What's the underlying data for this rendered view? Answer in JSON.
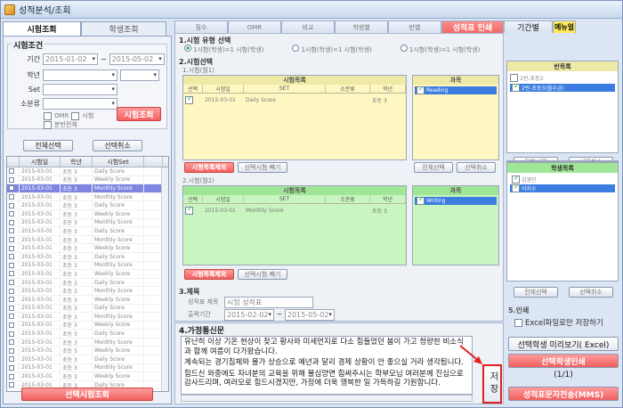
{
  "window": {
    "title": "성적분석/조회"
  },
  "left_tabs": [
    {
      "label": "시험조회",
      "active": true
    },
    {
      "label": "학생조회",
      "active": false
    }
  ],
  "left": {
    "condition_title": "시험조건",
    "period_label": "기간",
    "date_from": "2015-01-02",
    "date_to": "2015-05-02",
    "grade_label": "학년",
    "set_label": "Set",
    "class_label": "소분류",
    "check_omr": "OMR",
    "check_exam": "시험",
    "check_full": "분반전체",
    "search_button": "시험조회",
    "select_all": "전체선택",
    "deselect_all": "선택취소",
    "columns": [
      "",
      "시험일",
      "학년",
      "시험Set",
      ""
    ],
    "rows": [
      [
        "2015-03-01",
        "초등 3",
        "Daily Score"
      ],
      [
        "2015-03-01",
        "초등 3",
        "Weekly Score"
      ],
      [
        "2015-03-01",
        "초등 3",
        "Monthly Score"
      ],
      [
        "2015-03-01",
        "초등 3",
        "Monthly Score"
      ],
      [
        "2015-03-01",
        "초등 3",
        "Daily Score"
      ],
      [
        "2015-03-01",
        "초등 3",
        "Weekly Score"
      ],
      [
        "2015-03-01",
        "초등 3",
        "Monthly Score"
      ],
      [
        "2015-03-01",
        "초등 3",
        "Daily Score"
      ],
      [
        "2015-03-01",
        "초등 3",
        "Monthly Score"
      ],
      [
        "2015-03-01",
        "초등 3",
        "Weekly Score"
      ],
      [
        "2015-03-01",
        "초등 3",
        "Daily Score"
      ],
      [
        "2015-03-01",
        "초등 3",
        "Monthly Score"
      ],
      [
        "2015-03-01",
        "초등 3",
        "Weekly Score"
      ],
      [
        "2015-03-01",
        "초등 3",
        "Daily Score"
      ],
      [
        "2015-03-01",
        "초등 3",
        "Monthly Score"
      ],
      [
        "2015-03-01",
        "초등 3",
        "Weekly Score"
      ],
      [
        "2015-03-01",
        "초등 3",
        "Daily Score"
      ],
      [
        "2015-03-01",
        "초등 3",
        "Monthly Score"
      ],
      [
        "2015-03-01",
        "초등 3",
        "Weekly Score"
      ],
      [
        "2015-03-01",
        "초등 3",
        "Daily Score"
      ],
      [
        "2015-03-01",
        "초등 3",
        "Monthly Score"
      ],
      [
        "2015-03-01",
        "초등 3",
        "Weekly Score"
      ],
      [
        "2015-03-01",
        "초등 3",
        "Daily Score"
      ],
      [
        "2015-03-01",
        "초등 3",
        "Monthly Score"
      ],
      [
        "2015-03-01",
        "초등 3",
        "Weekly Score"
      ],
      [
        "2015-03-01",
        "초등 3",
        "Daily Score"
      ]
    ],
    "selected_row": 2,
    "bottom_button": "선택시험조회"
  },
  "top_tabs": [
    {
      "label": "점수",
      "style": ""
    },
    {
      "label": "OMR",
      "style": ""
    },
    {
      "label": "비교",
      "style": ""
    },
    {
      "label": "학생별",
      "style": ""
    },
    {
      "label": "반별",
      "style": ""
    },
    {
      "label": "성적표 인쇄",
      "style": "active"
    },
    {
      "label": "기간별",
      "style": "plain"
    },
    {
      "label": "메뉴얼",
      "style": "yellow"
    }
  ],
  "main": {
    "s1_title": "1.시험 유형 선택",
    "radio1": "1시험(학생)=1 시험(학생)",
    "radio2": "1시험(학생)=1 시험(학생)",
    "radio3": "1시험(학생)=1 시험(학생)",
    "s2_title": "2.시험선택",
    "exam1_label": "1.시험(월1)",
    "exam_list_title": "시험목록",
    "subject_title": "과목",
    "exam_cols": [
      "선택",
      "시험일",
      "SET",
      "소분류",
      "학년"
    ],
    "exam1_row": [
      "2015-03-01",
      "Daily Score",
      "초등 3"
    ],
    "exam1_subject": "Reading",
    "exam1_red_button": "시험목록제외",
    "exam1_button": "선택시험 빼기",
    "exam2_label": "2.시험(월2)",
    "exam2_row": [
      "2015-03-01",
      "Monthly Score",
      "초등 3"
    ],
    "exam2_subject": "Writing",
    "exam2_red_button": "시험목록제외",
    "exam2_button": "선택시험 빼기",
    "subj_select_all": "전체선택",
    "subj_deselect": "선택취소",
    "s3_title": "3.제목",
    "title_label": "성적표 제목",
    "title_value": "시험 성적표",
    "period_label": "출력기간",
    "period_from": "2015-02-02",
    "period_to": "2015-05-02"
  },
  "right": {
    "class_title": "반목록",
    "class_items": [
      "1반-초등3",
      "2반-초등3(월수금)"
    ],
    "student_title": "학생목록",
    "student_items": [
      "김영민",
      "이지수"
    ],
    "select_all": "전체선택",
    "deselect": "선택취소",
    "print_section": "5.인쇄",
    "excel_check": "Excel파일로만 저장하기",
    "preview_button": "선택학생 미리보기( Excel)",
    "print_button": "선택학생인쇄",
    "print_count": "(1/1)",
    "sms_button": "성적표문자전송(MMS)"
  },
  "message": {
    "title": "4.가정통신문",
    "p1": "유난히 이상 기온 현상이 잦고 황사와 미세먼지로 다소 힘들었던 봄이 가고 청량한 비소식과 함께 여름이 다가왔습니다.",
    "p2": "계속되는 경기침체와 물가 상승으로 예년과 달리 경제 상황이 안 좋으실 거라 생각됩니다.",
    "p3": "힘드신 와중에도 자녀분의 교육을 위해 물심양면 힘써주시는 학부모님 여러분께 진심으로 감사드리며, 여러모로 힘드시겠지만, 가정에 더욱 행복한 일 가득하길 기원합니다.",
    "save_label": "저장"
  },
  "colors": {
    "accent_red": "#f06060",
    "selection_blue": "#3b7de0",
    "yellow_panel": "#fff7c2",
    "green_panel": "#c9f5c0"
  }
}
